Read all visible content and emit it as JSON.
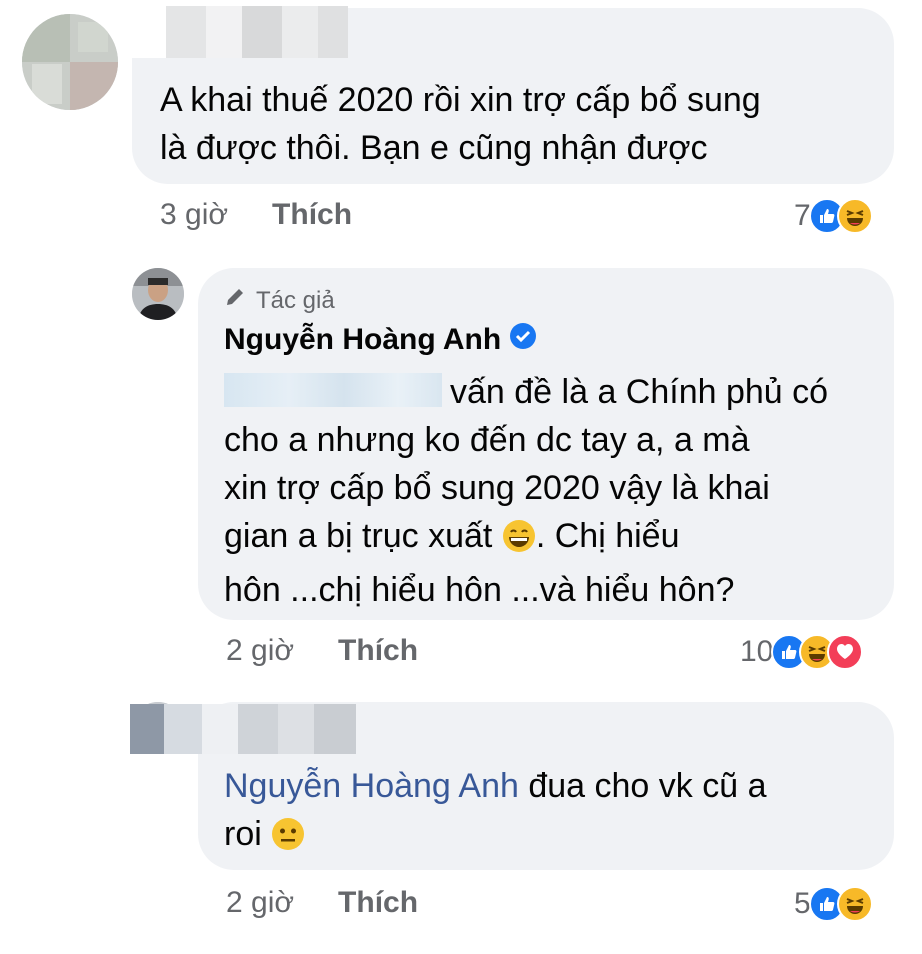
{
  "comments": [
    {
      "text_line1": "A khai thuế 2020 rồi xin trợ cấp bổ sung",
      "text_line2": "là được thôi. Bạn e cũng nhận được",
      "time": "3 giờ",
      "like_label": "Thích",
      "reaction_count": "7",
      "reactions": [
        "like-icon",
        "haha-icon"
      ]
    },
    {
      "badge": "Tác giả",
      "author": "Nguyễn Hoàng Anh",
      "verified": true,
      "text_line1_after_mention": "vấn đề là a Chính phủ có",
      "text_line2": "cho a nhưng ko đến dc tay a, a mà",
      "text_line3": "xin trợ cấp bổ sung 2020 vậy là khai",
      "text_line4_before_emoji": "gian a bị trục xuất",
      "text_line4_after_emoji": ". Chị hiểu",
      "text_line5": "hôn ...chị hiểu hôn ...và hiểu hôn?",
      "time": "2 giờ",
      "like_label": "Thích",
      "reaction_count": "10",
      "reactions": [
        "like-icon",
        "haha-icon",
        "love-icon"
      ]
    },
    {
      "mention": "Nguyễn Hoàng Anh",
      "text_line1_after_mention": " đua cho vk cũ a",
      "text_line2": "roi",
      "time": "2 giờ",
      "like_label": "Thích",
      "reaction_count": "5",
      "reactions": [
        "like-icon",
        "haha-icon"
      ]
    }
  ],
  "colors": {
    "bubble": "#f0f2f5",
    "meta_text": "#65676b",
    "mention": "#385898",
    "like_blue": "#1877f2",
    "haha_yellow": "#f7b928",
    "love_red": "#f33e58"
  }
}
